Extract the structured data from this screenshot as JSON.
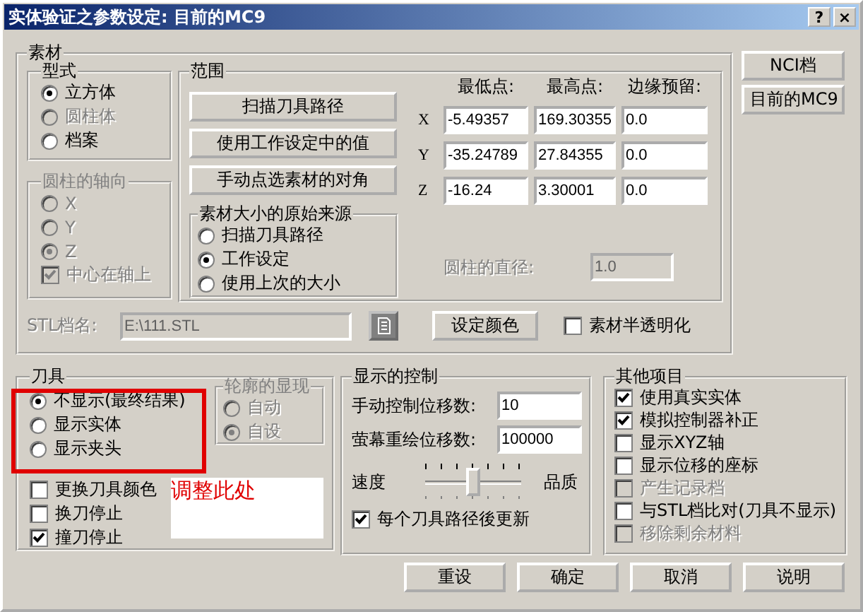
{
  "window": {
    "title": "实体验证之参数设定: 目前的MC9",
    "buttons": [
      "?",
      "×"
    ]
  },
  "stock": {
    "title": "素材",
    "shape": {
      "title": "型式",
      "options": [
        {
          "label": "立方体",
          "selected": true,
          "disabled": false
        },
        {
          "label": "圆柱体",
          "selected": false,
          "disabled": true
        },
        {
          "label": "档案",
          "selected": false,
          "disabled": false
        }
      ]
    },
    "cylinder_axis": {
      "title": "圆柱的轴向",
      "disabled": true,
      "options": [
        {
          "label": "X",
          "selected": false,
          "disabled": true
        },
        {
          "label": "Y",
          "selected": false,
          "disabled": true
        },
        {
          "label": "Z",
          "selected": true,
          "disabled": true
        }
      ],
      "center_on_axis": {
        "label": "中心在轴上",
        "checked": true,
        "disabled": true
      }
    },
    "range": {
      "title": "范围",
      "buttons": [
        "扫描刀具路径",
        "使用工作设定中的值",
        "手动点选素材的对角"
      ],
      "source": {
        "title": "素材大小的原始来源",
        "options": [
          {
            "label": "扫描刀具路径",
            "selected": false,
            "disabled": false
          },
          {
            "label": "工作设定",
            "selected": true,
            "disabled": false
          },
          {
            "label": "使用上次的大小",
            "selected": false,
            "disabled": false
          }
        ]
      },
      "columns": [
        "最低点:",
        "最高点:",
        "边缘预留:"
      ],
      "rows": [
        {
          "axis": "X",
          "values": [
            "-5.49357",
            "169.30355",
            "0.0"
          ]
        },
        {
          "axis": "Y",
          "values": [
            "-35.24789",
            "27.84355",
            "0.0"
          ]
        },
        {
          "axis": "Z",
          "values": [
            "-16.24",
            "3.30001",
            "0.0"
          ]
        }
      ],
      "diameter": {
        "label": "圆柱的直径:",
        "value": "1.0",
        "disabled": true
      }
    },
    "stl": {
      "label": "STL档名:",
      "value": "E:\\111.STL",
      "disabled": true
    },
    "color_button": "设定颜色",
    "translucent": {
      "label": "素材半透明化",
      "checked": false
    }
  },
  "side_buttons": [
    "NCI档",
    "目前的MC9"
  ],
  "tool": {
    "title": "刀具",
    "options": [
      {
        "label": "不显示(最终结果)",
        "selected": true,
        "disabled": false
      },
      {
        "label": "显示实体",
        "selected": false,
        "disabled": false
      },
      {
        "label": "显示夹头",
        "selected": false,
        "disabled": false
      }
    ],
    "outline": {
      "title": "轮廓的显现",
      "disabled": true,
      "options": [
        {
          "label": "自动",
          "selected": false,
          "disabled": true
        },
        {
          "label": "自设",
          "selected": true,
          "disabled": true
        }
      ]
    },
    "checks": [
      {
        "label": "更换刀具颜色",
        "checked": false,
        "disabled": false
      },
      {
        "label": "换刀停止",
        "checked": false,
        "disabled": false
      },
      {
        "label": "撞刀停止",
        "checked": true,
        "disabled": false
      }
    ],
    "annotation": "调整此处"
  },
  "display": {
    "title": "显示的控制",
    "fields": [
      {
        "label": "手动控制位移数:",
        "value": "10"
      },
      {
        "label": "萤幕重绘位移数:",
        "value": "100000"
      }
    ],
    "speed": {
      "left": "速度",
      "right": "品质",
      "level": 0.5
    },
    "update": {
      "label": "每个刀具路径後更新",
      "checked": true,
      "disabled": false
    }
  },
  "other": {
    "title": "其他项目",
    "items": [
      {
        "label": "使用真实实体",
        "checked": true,
        "disabled": false
      },
      {
        "label": "模拟控制器补正",
        "checked": true,
        "disabled": false
      },
      {
        "label": "显示XYZ轴",
        "checked": false,
        "disabled": false
      },
      {
        "label": "显示位移的座标",
        "checked": false,
        "disabled": false
      },
      {
        "label": "产生记录档",
        "checked": false,
        "disabled": true
      },
      {
        "label": "与STL档比对(刀具不显示)",
        "checked": false,
        "disabled": false
      },
      {
        "label": "移除剩余材料",
        "checked": false,
        "disabled": true
      }
    ]
  },
  "buttons": [
    "重设",
    "确定",
    "取消",
    "说明"
  ]
}
